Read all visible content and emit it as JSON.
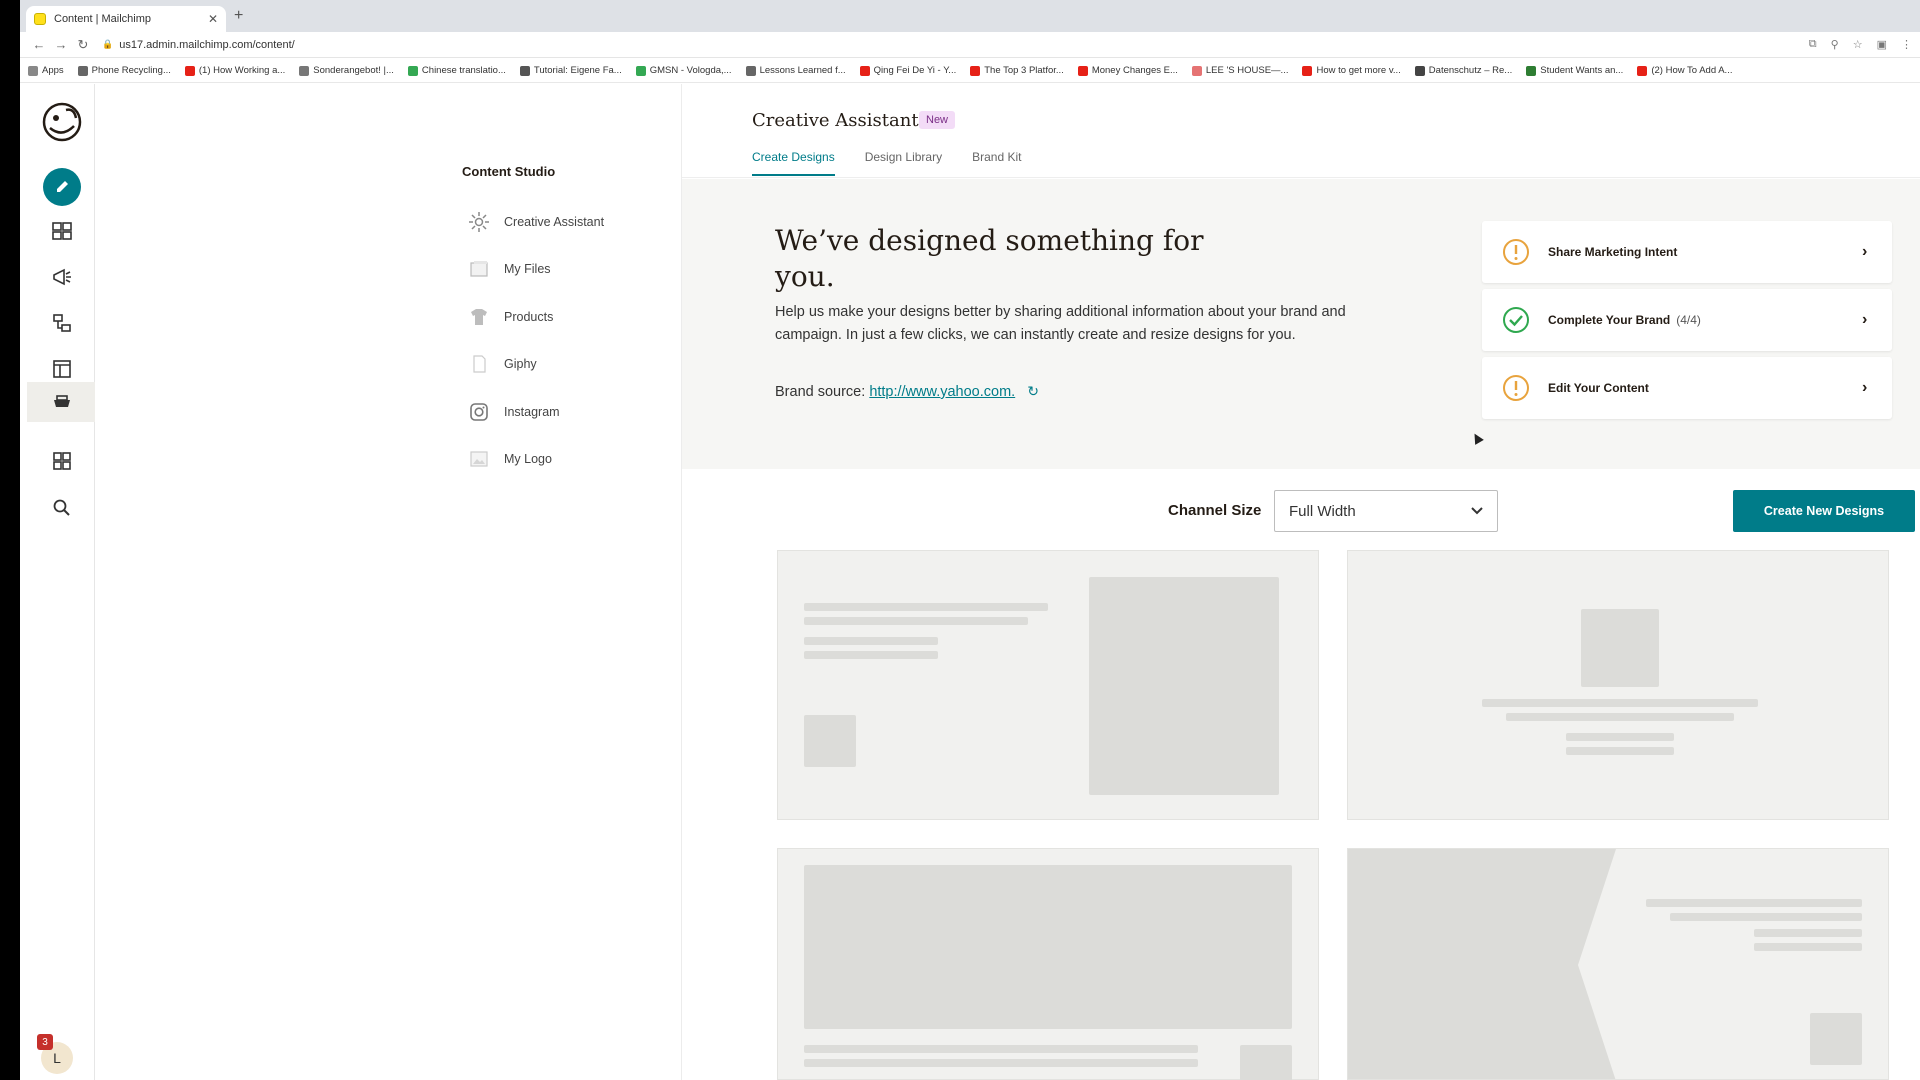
{
  "browser": {
    "tab_title": "Content | Mailchimp",
    "url": "us17.admin.mailchimp.com/content/",
    "bookmarks": [
      {
        "label": "Apps",
        "color": "#888888"
      },
      {
        "label": "Phone Recycling...",
        "color": "#666666"
      },
      {
        "label": "(1) How Working a...",
        "color": "#e62117"
      },
      {
        "label": "Sonderangebot! |...",
        "color": "#777777"
      },
      {
        "label": "Chinese translatio...",
        "color": "#34a853"
      },
      {
        "label": "Tutorial: Eigene Fa...",
        "color": "#555555"
      },
      {
        "label": "GMSN - Vologda,...",
        "color": "#34a853"
      },
      {
        "label": "Lessons Learned f...",
        "color": "#666666"
      },
      {
        "label": "Qing Fei De Yi - Y...",
        "color": "#e62117"
      },
      {
        "label": "The Top 3 Platfor...",
        "color": "#e62117"
      },
      {
        "label": "Money Changes E...",
        "color": "#e62117"
      },
      {
        "label": "LEE 'S HOUSE—...",
        "color": "#e57373"
      },
      {
        "label": "How to get more v...",
        "color": "#e62117"
      },
      {
        "label": "Datenschutz – Re...",
        "color": "#444444"
      },
      {
        "label": "Student Wants an...",
        "color": "#2e7d32"
      },
      {
        "label": "(2) How To Add A...",
        "color": "#e62117"
      }
    ]
  },
  "sidebar": {
    "title": "Content Studio",
    "items": [
      {
        "label": "Creative Assistant",
        "icon": "sparkle-icon"
      },
      {
        "label": "My Files",
        "icon": "files-icon"
      },
      {
        "label": "Products",
        "icon": "shirt-icon"
      },
      {
        "label": "Giphy",
        "icon": "file-icon"
      },
      {
        "label": "Instagram",
        "icon": "instagram-icon"
      },
      {
        "label": "My Logo",
        "icon": "image-icon"
      }
    ]
  },
  "header": {
    "title": "Creative Assistant",
    "badge": "New",
    "tabs": [
      "Create Designs",
      "Design Library",
      "Brand Kit"
    ]
  },
  "hero": {
    "heading": "We’ve designed something for you.",
    "body": "Help us make your designs better by sharing additional information about your brand and campaign. In just a few clicks, we can instantly create and resize designs for you.",
    "brand_source_label": "Brand source:",
    "brand_source_link": "http://www.yahoo.com."
  },
  "steps": [
    {
      "label": "Share Marketing Intent",
      "count": "",
      "status": "warning",
      "icon": "warning-icon"
    },
    {
      "label": "Complete Your Brand",
      "count": "(4/4)",
      "status": "complete",
      "icon": "check-circle-icon"
    },
    {
      "label": "Edit Your Content",
      "count": "",
      "status": "warning",
      "icon": "warning-icon"
    }
  ],
  "controls": {
    "channel_size_label": "Channel Size",
    "channel_size_value": "Full Width",
    "create_button": "Create New Designs"
  },
  "rail": {
    "notification_count": "3",
    "avatar_initial": "L"
  },
  "colors": {
    "brand_teal": "#007c89",
    "mailchimp_yellow": "#ffe01b",
    "warning": "#e8a33d",
    "success": "#2fa84f",
    "badge_bg": "#f3dcf7"
  }
}
